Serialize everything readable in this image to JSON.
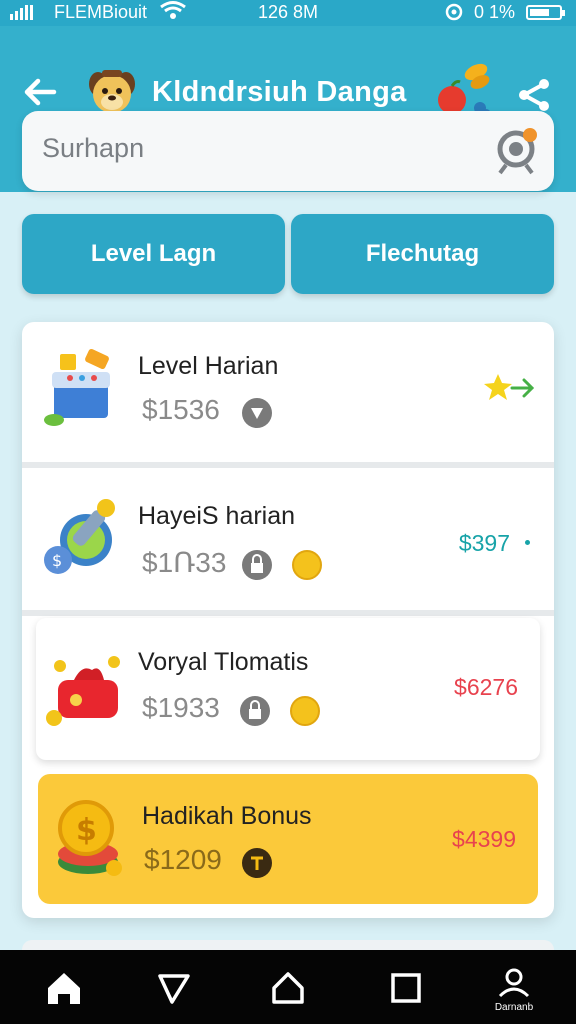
{
  "status_bar": {
    "carrier": "FLEMBiouit",
    "time": "126 8M",
    "battery_text": "0 1%"
  },
  "header": {
    "title": "Kldndrsiuh Danga"
  },
  "search": {
    "placeholder": "Surhapn"
  },
  "tabs": [
    {
      "label": "Level Lagn"
    },
    {
      "label": "Flechutag"
    }
  ],
  "rows": [
    {
      "name": "Level Harian",
      "price": "$1536",
      "value": "",
      "value_color": "#1aa0a8",
      "icon": "gift-box-icon"
    },
    {
      "name": "HayeiS harian",
      "price": "$1Ռ33",
      "value": "$397",
      "value_color": "#17a3a8",
      "icon": "key-icon"
    },
    {
      "name": "Voryal Tlomatis",
      "price": "$1933",
      "value": "$6276",
      "value_color": "#e8424e",
      "icon": "wallet-icon"
    },
    {
      "name": "Hadikah Bonus",
      "price": "$1209",
      "value": "$4399",
      "value_color": "#e8424e",
      "icon": "coin-stack-icon"
    }
  ],
  "nav": {
    "label": "Darnanb"
  }
}
